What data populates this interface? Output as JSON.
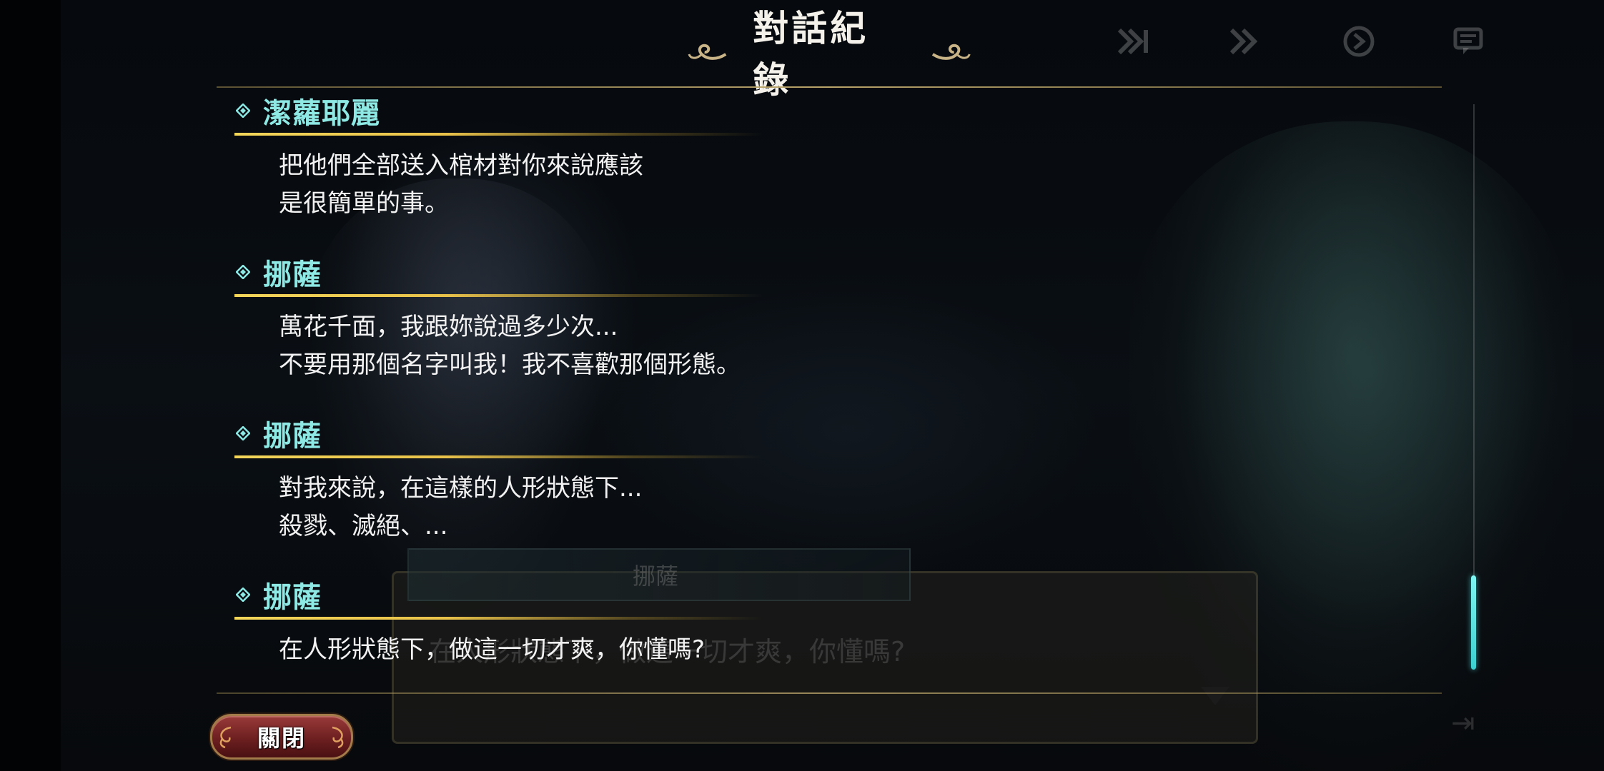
{
  "header": {
    "title": "對話紀錄",
    "icons": [
      "skip-icon",
      "fast-forward-icon",
      "auto-play-icon",
      "log-icon"
    ]
  },
  "background": {
    "speaker": "挪薩",
    "line": "在人形狀態下，做這一切才爽，你懂嗎?"
  },
  "entries": [
    {
      "speaker": "潔蘿耶麗",
      "lines": [
        "把他們全部送入棺材對你來說應該",
        "是很簡單的事。"
      ]
    },
    {
      "speaker": "挪薩",
      "lines": [
        "萬花千面，我跟妳說過多少次...",
        "不要用那個名字叫我！我不喜歡那個形態。"
      ]
    },
    {
      "speaker": "挪薩",
      "lines": [
        "對我來說，在這樣的人形狀態下...",
        "殺戮、滅絕、..."
      ]
    },
    {
      "speaker": "挪薩",
      "lines": [
        "在人形狀態下，做這一切才爽，你懂嗎?"
      ]
    }
  ],
  "footer": {
    "close_label": "關閉"
  },
  "colors": {
    "speaker": "#8ee8e4",
    "accent_gold": "#e9c24a",
    "scroll_thumb": "#5fe6e4",
    "close_button": "#7a2425"
  }
}
